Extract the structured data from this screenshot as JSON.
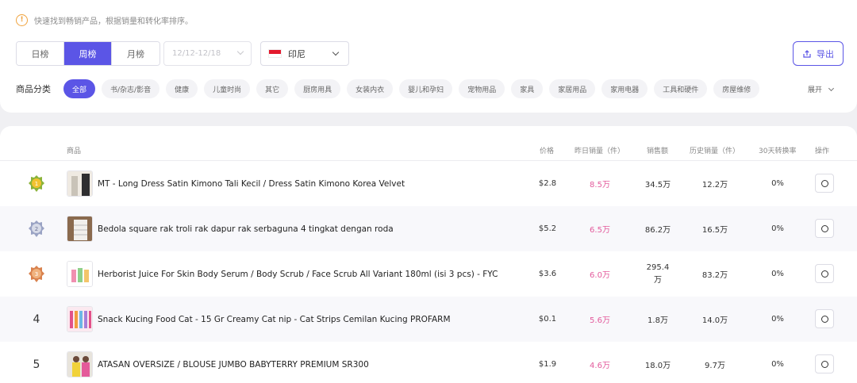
{
  "notice": {
    "icon": "warning-icon",
    "text": "快速找到畅销产品，根据销量和转化率排序。"
  },
  "period_tabs": [
    {
      "label": "日榜",
      "active": false
    },
    {
      "label": "周榜",
      "active": true
    },
    {
      "label": "月榜",
      "active": false
    }
  ],
  "date_range": {
    "placeholder": "12/12-12/18"
  },
  "country": {
    "label": "印尼",
    "flag": "indonesia-flag-icon"
  },
  "export": {
    "label": "导出",
    "icon": "export-icon"
  },
  "category": {
    "label": "商品分类",
    "chips": [
      {
        "label": "全部",
        "active": true
      },
      {
        "label": "书/杂志/影音"
      },
      {
        "label": "健康"
      },
      {
        "label": "儿童时尚"
      },
      {
        "label": "其它"
      },
      {
        "label": "厨房用具"
      },
      {
        "label": "女装内衣"
      },
      {
        "label": "婴儿和孕妇"
      },
      {
        "label": "宠物用品"
      },
      {
        "label": "家具"
      },
      {
        "label": "家居用品"
      },
      {
        "label": "家用电器"
      },
      {
        "label": "工具和硬件"
      },
      {
        "label": "房屋维修"
      }
    ],
    "expand_label": "展开"
  },
  "table": {
    "headers": {
      "product": "商品",
      "price": "价格",
      "yesterday_sales": "昨日销量（件）",
      "revenue": "销售额",
      "history_sales": "历史销量（件）",
      "conversion": "30天转换率",
      "action": "操作"
    },
    "rows": [
      {
        "rank": "1",
        "medal": "gold",
        "name": "MT - Long Dress Satin Kimono Tali Kecil / Dress Satin Kimono Korea Velvet",
        "price": "$2.8",
        "yesterday": "8.5万",
        "revenue": "34.5万",
        "history": "12.2万",
        "conversion": "0%"
      },
      {
        "rank": "2",
        "medal": "silver",
        "name": "Bedola square rak troli rak dapur rak serbaguna 4 tingkat dengan roda",
        "price": "$5.2",
        "yesterday": "6.5万",
        "revenue": "86.2万",
        "history": "16.5万",
        "conversion": "0%"
      },
      {
        "rank": "3",
        "medal": "bronze",
        "name": "Herborist Juice For Skin Body Serum / Body Scrub / Face Scrub All Variant 180ml (isi 3 pcs) - FYC",
        "price": "$3.6",
        "yesterday": "6.0万",
        "revenue": "295.4万",
        "history": "83.2万",
        "conversion": "0%"
      },
      {
        "rank": "4",
        "medal": "",
        "name": "Snack Kucing Food Cat - 15 Gr Creamy Cat nip - Cat Strips Cemilan Kucing PROFARM",
        "price": "$0.1",
        "yesterday": "5.6万",
        "revenue": "1.8万",
        "history": "14.0万",
        "conversion": "0%"
      },
      {
        "rank": "5",
        "medal": "",
        "name": "ATASAN OVERSIZE / BLOUSE JUMBO BABYTERRY PREMIUM SR300",
        "price": "$1.9",
        "yesterday": "4.6万",
        "revenue": "18.0万",
        "history": "9.7万",
        "conversion": "0%"
      }
    ]
  },
  "colors": {
    "accent": "#5b55e6",
    "sales_pink": "#e35b9c",
    "warning": "#f0a33e"
  }
}
